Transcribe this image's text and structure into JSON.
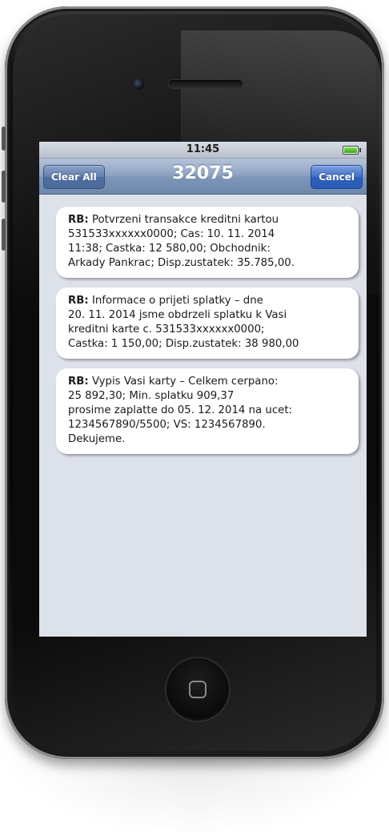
{
  "status_bar": {
    "time": "11:45",
    "battery_icon": "battery-full-icon"
  },
  "nav_bar": {
    "title": "32075",
    "left_button": "Clear All",
    "right_button": "Cancel"
  },
  "messages": [
    {
      "sender": "RB:",
      "lines": [
        "Potvrzeni transakce kreditni kartou",
        "531533xxxxxx0000; Cas: 10. 11. 2014",
        "11:38;  Castka: 12 580,00; Obchodnik:",
        "Arkady Pankrac; Disp.zustatek: 35.785,00."
      ]
    },
    {
      "sender": "RB:",
      "lines": [
        "Informace o prijeti splatky – dne",
        "20. 11. 2014 jsme obdrzeli splatku k Vasi",
        "kreditni karte c. 531533xxxxxx0000;",
        "Castka: 1 150,00; Disp.zustatek: 38 980,00"
      ]
    },
    {
      "sender": "RB:",
      "lines": [
        "Vypis Vasi karty – Celkem cerpano:",
        "25 892,30; Min. splatku 909,37",
        "prosime zaplatte do 05. 12. 2014 na ucet:",
        "1234567890/5500; VS: 1234567890.",
        "Dekujeme."
      ]
    }
  ]
}
